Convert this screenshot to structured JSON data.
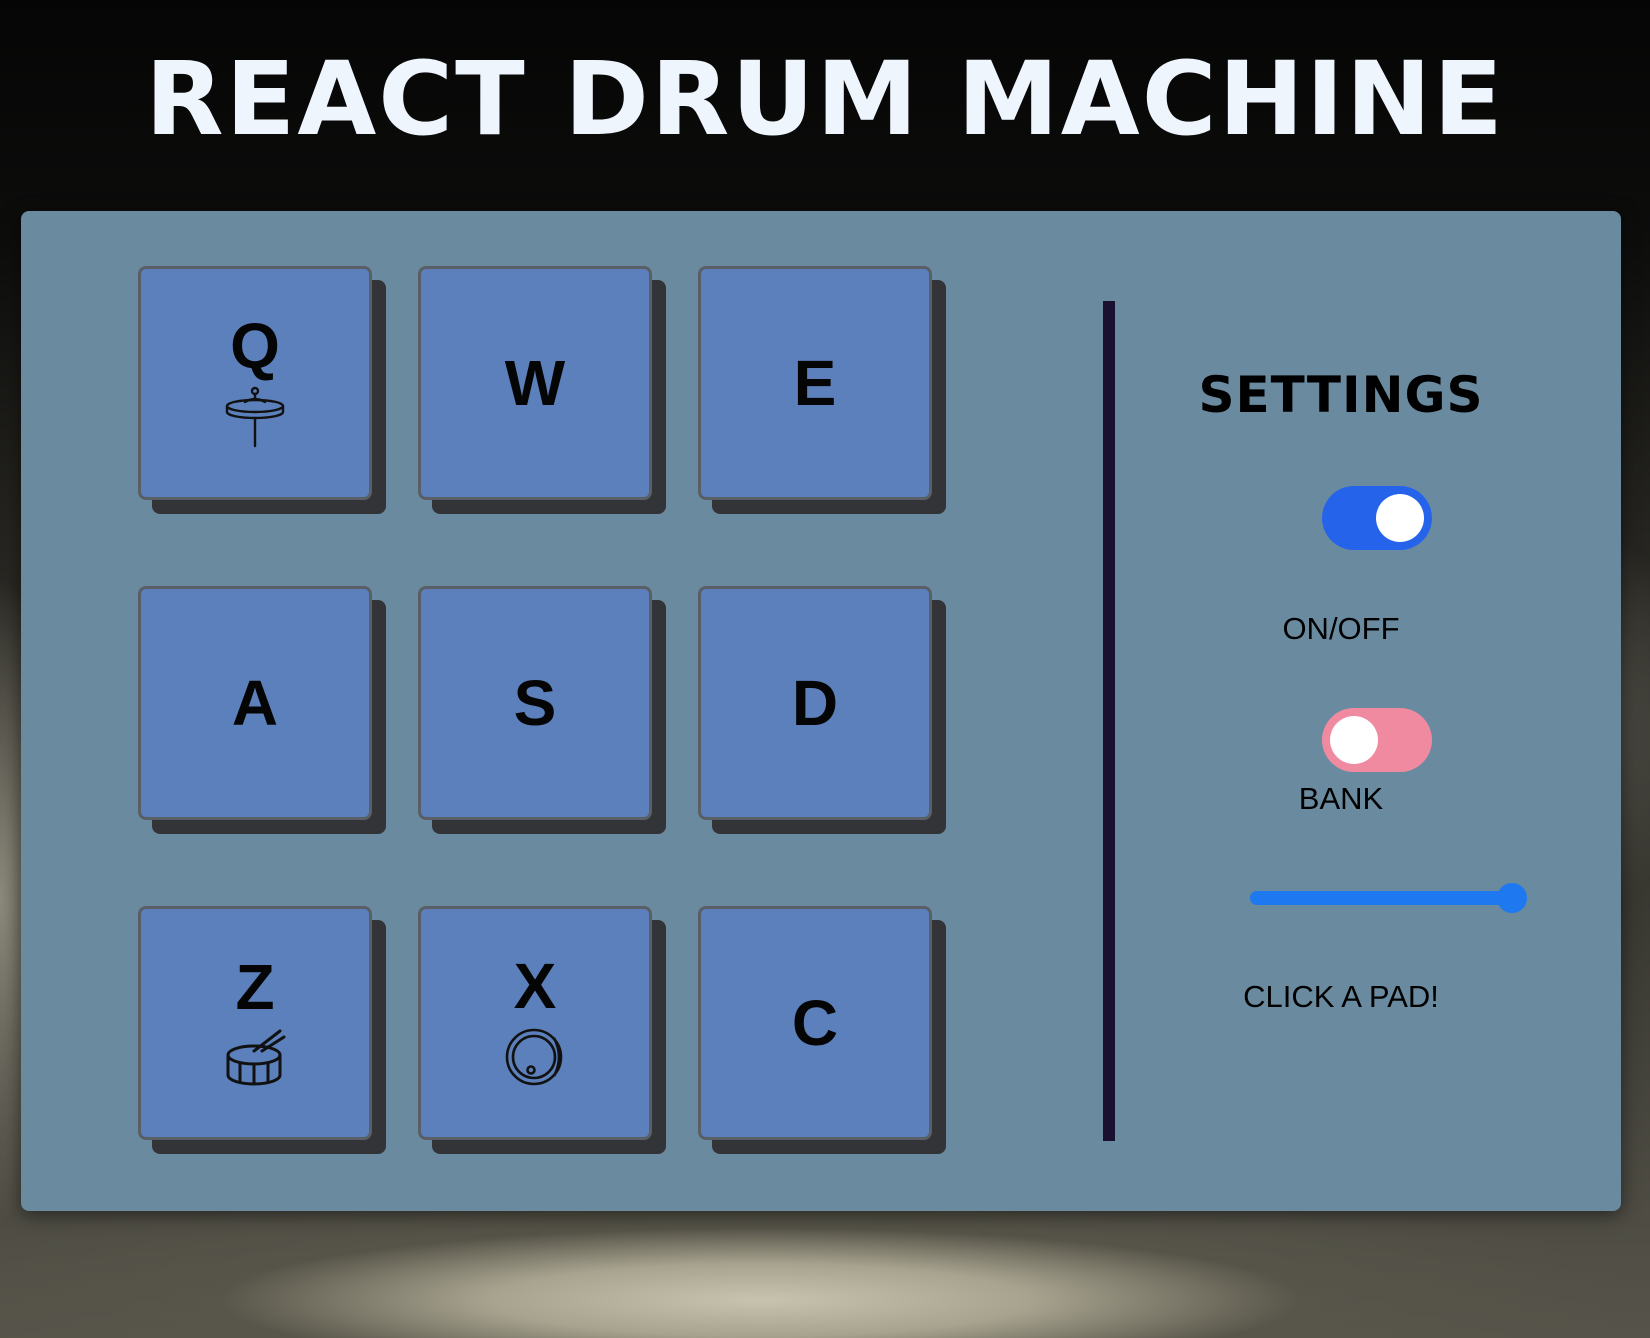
{
  "app": {
    "title": "REACT DRUM MACHINE"
  },
  "pads": [
    {
      "key": "Q",
      "icon": "hi-hat-icon"
    },
    {
      "key": "W",
      "icon": ""
    },
    {
      "key": "E",
      "icon": ""
    },
    {
      "key": "A",
      "icon": ""
    },
    {
      "key": "S",
      "icon": ""
    },
    {
      "key": "D",
      "icon": ""
    },
    {
      "key": "Z",
      "icon": "snare-drum-icon"
    },
    {
      "key": "X",
      "icon": "bass-drum-icon"
    },
    {
      "key": "C",
      "icon": ""
    }
  ],
  "settings": {
    "title": "SETTINGS",
    "power": {
      "label": "ON/OFF",
      "on": true,
      "color": "#2563eb"
    },
    "bank": {
      "label": "BANK",
      "on": false,
      "color": "#f08aa0"
    },
    "volume": {
      "value": 1.0
    },
    "display": "CLICK A PAD!"
  },
  "colors": {
    "pad": "#5b80bb",
    "panel": "#6a8aa0",
    "accent": "#1e78f0"
  }
}
